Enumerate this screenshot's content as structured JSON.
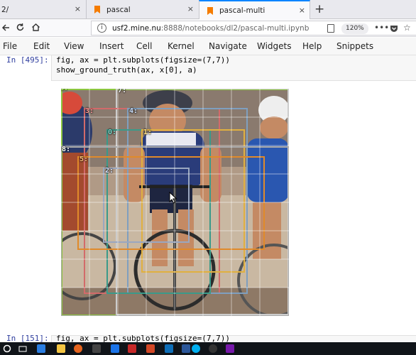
{
  "browser": {
    "tabs": [
      {
        "label": "2/",
        "active": false
      },
      {
        "label": "pascal",
        "active": false
      },
      {
        "label": "pascal-multi",
        "active": true
      }
    ],
    "new_tab_glyph": "+",
    "close_glyph": "×",
    "url_host": "usf2.mine.nu",
    "url_rest": ":8888/notebooks/dl2/pascal-multi.ipynb",
    "zoom": "120%",
    "accent_color": "#0a84ff"
  },
  "menubar": {
    "items": [
      "File",
      "Edit",
      "View",
      "Insert",
      "Cell",
      "Kernel",
      "Navigate",
      "Widgets",
      "Help",
      "Snippets"
    ]
  },
  "cell": {
    "prompt": "In [495]:",
    "line1": "fig, ax = plt.subplots(figsize=(7,7))",
    "line2": "show_ground_truth(ax, x[0], a)"
  },
  "figure": {
    "box_labels": [
      "6:",
      "7:",
      "3:",
      "4:",
      "0:",
      "1:",
      "8:",
      "5:",
      "2:"
    ],
    "box_colors": [
      "#8cc63f",
      "#cccccc",
      "#d26a6a",
      "#7f9fbf",
      "#3a9a8a",
      "#e0b040",
      "#aaaaaa",
      "#e08a2a",
      "#9aa7c0"
    ]
  },
  "next_cell": {
    "prompt": "In [151]:",
    "line1": "fig, ax = plt.subplots(figsize=(7,7))"
  }
}
